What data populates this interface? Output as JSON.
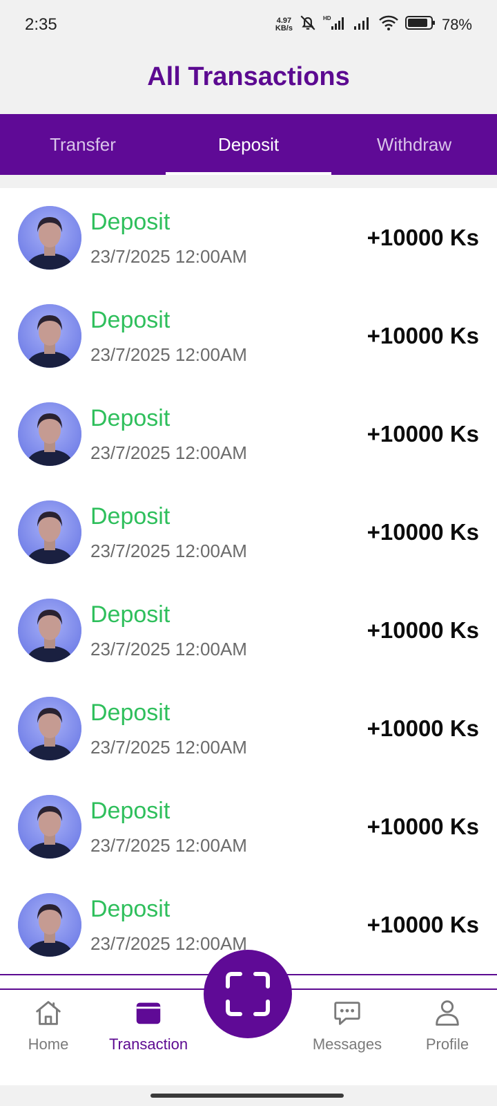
{
  "status_bar": {
    "time": "2:35",
    "net_speed_value": "4.97",
    "net_speed_unit": "KB/s",
    "battery": "78%",
    "icons": [
      "mute-bell-icon",
      "hd-signal-icon",
      "signal-icon",
      "wifi-icon",
      "battery-icon"
    ]
  },
  "header": {
    "title": "All Transactions"
  },
  "tabs": [
    {
      "label": "Transfer",
      "active": false
    },
    {
      "label": "Deposit",
      "active": true
    },
    {
      "label": "Withdraw",
      "active": false
    }
  ],
  "transactions": [
    {
      "type": "Deposit",
      "date": "23/7/2025 12:00AM",
      "amount": "+10000 Ks"
    },
    {
      "type": "Deposit",
      "date": "23/7/2025 12:00AM",
      "amount": "+10000 Ks"
    },
    {
      "type": "Deposit",
      "date": "23/7/2025 12:00AM",
      "amount": "+10000 Ks"
    },
    {
      "type": "Deposit",
      "date": "23/7/2025 12:00AM",
      "amount": "+10000 Ks"
    },
    {
      "type": "Deposit",
      "date": "23/7/2025 12:00AM",
      "amount": "+10000 Ks"
    },
    {
      "type": "Deposit",
      "date": "23/7/2025 12:00AM",
      "amount": "+10000 Ks"
    },
    {
      "type": "Deposit",
      "date": "23/7/2025 12:00AM",
      "amount": "+10000 Ks"
    },
    {
      "type": "Deposit",
      "date": "23/7/2025 12:00AM",
      "amount": "+10000 Ks"
    }
  ],
  "bottom_nav": {
    "home": "Home",
    "transaction": "Transaction",
    "messages": "Messages",
    "profile": "Profile",
    "active": "transaction"
  },
  "colors": {
    "brand_purple": "#5f0a96",
    "deposit_green": "#2fbf5c",
    "background": "#f1f1f1"
  }
}
